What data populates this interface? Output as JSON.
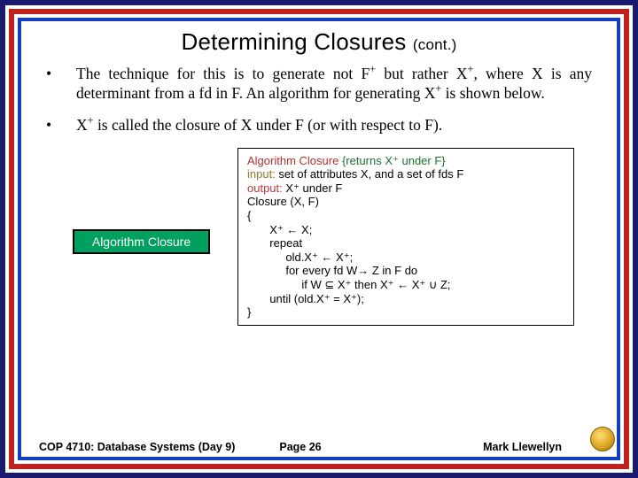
{
  "title": {
    "main": "Determining Closures",
    "cont": "(cont.)"
  },
  "bullets": {
    "b1_pre": "The technique for this is to generate not F",
    "b1_mid": " but rather X",
    "b1_post": ", where X is any determinant from a fd in F.  An algorithm for generating X",
    "b1_end": " is shown below.",
    "b2_pre": "X",
    "b2_post": " is called the closure of X under F (or with respect to F).",
    "sup_plus": "+",
    "dot": "•"
  },
  "algoLabel": "Algorithm Closure",
  "algo": {
    "l1_name": "Algorithm Closure ",
    "l1_comment": " {returns X⁺ under F}",
    "l2_label": "input: ",
    "l2_text": " set of attributes X, and a set of fds F",
    "l3_label": "output:",
    "l3_text": " X⁺ under F",
    "l4": "Closure (X, F)",
    "l5": "{",
    "l6": "       X⁺ ← X;",
    "l7": "       repeat",
    "l8": "            old.X⁺ ← X⁺;",
    "l9": "            for every fd W→ Z in F do",
    "l10": "                 if W ⊆ X⁺ then X⁺ ← X⁺ ∪ Z;",
    "l11": "       until (old.X⁺ = X⁺);",
    "l12": "}"
  },
  "footer": {
    "left": "COP 4710: Database Systems (Day 9)",
    "mid": "Page 26",
    "right": "Mark Llewellyn"
  }
}
